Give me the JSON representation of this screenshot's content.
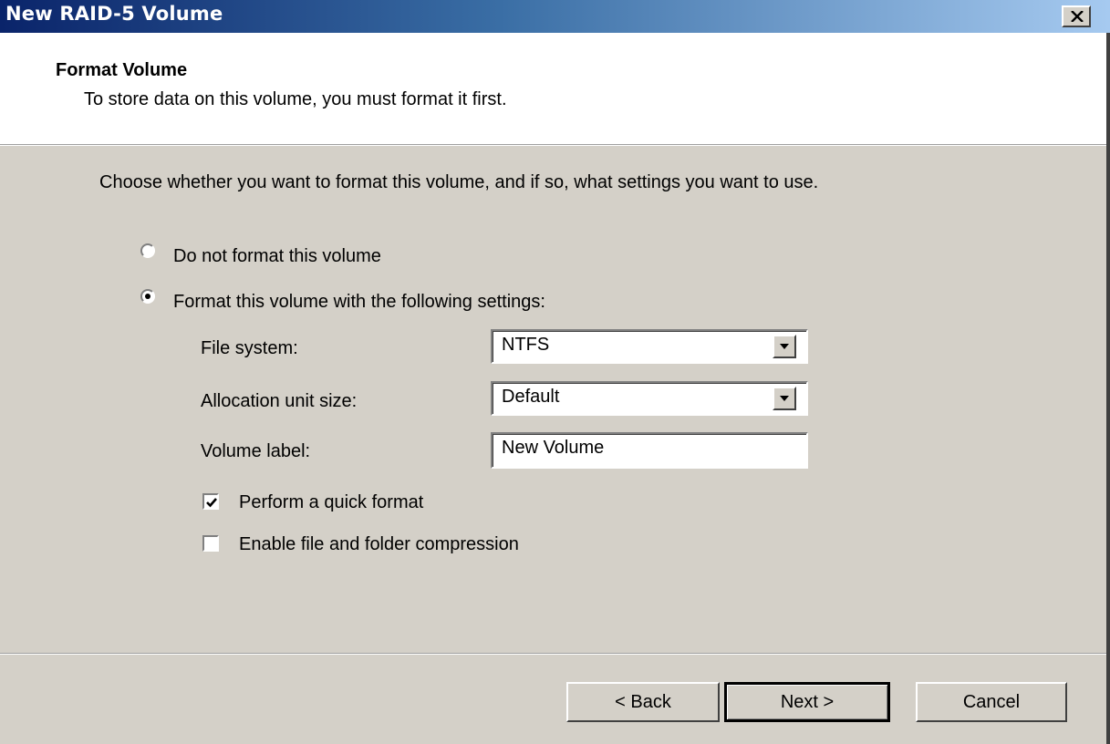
{
  "window": {
    "title": "New RAID-5 Volume",
    "close_icon": "close-icon"
  },
  "header": {
    "title": "Format Volume",
    "subtitle": "To store data on this volume, you must format it first."
  },
  "main": {
    "instruction": "Choose whether you want to format this volume, and if so, what settings you want to use.",
    "options": [
      {
        "label": "Do not format this volume",
        "selected": false
      },
      {
        "label": "Format this volume with the following settings:",
        "selected": true
      }
    ],
    "settings": {
      "file_system_label": "File system:",
      "file_system_value": "NTFS",
      "allocation_label": "Allocation unit size:",
      "allocation_value": "Default",
      "volume_label_label": "Volume label:",
      "volume_label_value": "New Volume"
    },
    "checkboxes": [
      {
        "label": "Perform a quick format",
        "checked": true
      },
      {
        "label": "Enable file and folder compression",
        "checked": false
      }
    ]
  },
  "footer": {
    "back_label": "< Back",
    "next_label": "Next >",
    "cancel_label": "Cancel"
  }
}
